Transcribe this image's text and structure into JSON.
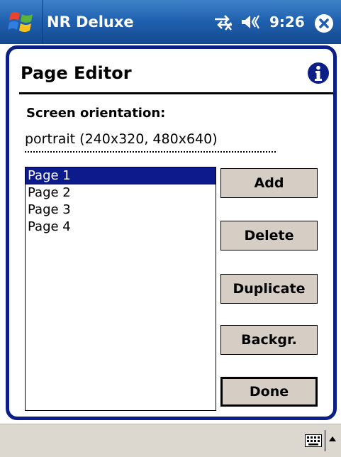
{
  "titlebar": {
    "app_title": "NR Deluxe",
    "time": "9:26",
    "start_icon": "windows-start-flag-icon",
    "connectivity_icon": "connectivity-icon",
    "volume_icon": "speaker-icon",
    "close_icon": "close-icon"
  },
  "dialog": {
    "title": "Page Editor",
    "info_icon": "info-icon",
    "orientation_label": "Screen orientation:",
    "orientation_value": "portrait (240x320, 480x640)"
  },
  "pages": {
    "items": [
      "Page 1",
      "Page 2",
      "Page 3",
      "Page 4"
    ],
    "selected": "Page 1"
  },
  "buttons": {
    "add": "Add",
    "delete": "Delete",
    "duplicate": "Duplicate",
    "background": "Backgr.",
    "done": "Done"
  },
  "menubar": {
    "keyboard_icon": "keyboard-icon",
    "sip_arrow_icon": "up-arrow-icon"
  },
  "colors": {
    "titlebar": "#1f5fae",
    "dialog_border": "#0b1f86",
    "selection": "#0d1a8c",
    "button_face": "#d6cec5",
    "menubar": "#dcd7cf"
  }
}
